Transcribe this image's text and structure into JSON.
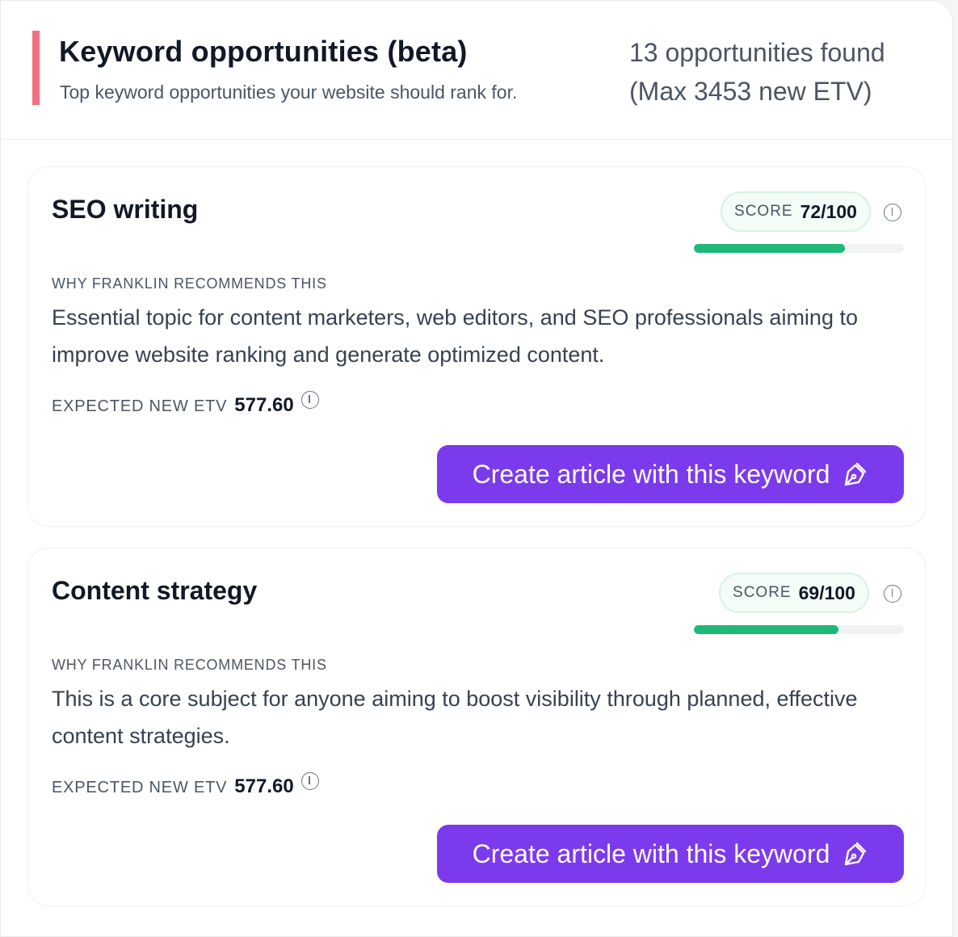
{
  "header": {
    "title": "Keyword opportunities (beta)",
    "subtitle": "Top keyword opportunities your website should rank for.",
    "count_line1": "13 opportunities found",
    "count_line2": "(Max 3453 new ETV)"
  },
  "colors": {
    "accent": "#f2707e",
    "button": "#7c3aed",
    "progress": "#1fb879"
  },
  "cards": [
    {
      "title": "SEO writing",
      "score_label": "SCORE",
      "score_value": "72/100",
      "score": 72,
      "score_max": 100,
      "why_label": "WHY FRANKLIN RECOMMENDS THIS",
      "why_text": "Essential topic for content marketers, web editors, and SEO professionals aiming to improve website ranking and generate optimized content.",
      "etv_label": "EXPECTED NEW ETV",
      "etv_value": "577.60",
      "button_label": "Create article with this keyword",
      "button_icon": "pen-icon"
    },
    {
      "title": "Content strategy",
      "score_label": "SCORE",
      "score_value": "69/100",
      "score": 69,
      "score_max": 100,
      "why_label": "WHY FRANKLIN RECOMMENDS THIS",
      "why_text": "This is a core subject for anyone aiming to boost visibility through planned, effective content strategies.",
      "etv_label": "EXPECTED NEW ETV",
      "etv_value": "577.60",
      "button_label": "Create article with this keyword",
      "button_icon": "pen-icon"
    }
  ]
}
